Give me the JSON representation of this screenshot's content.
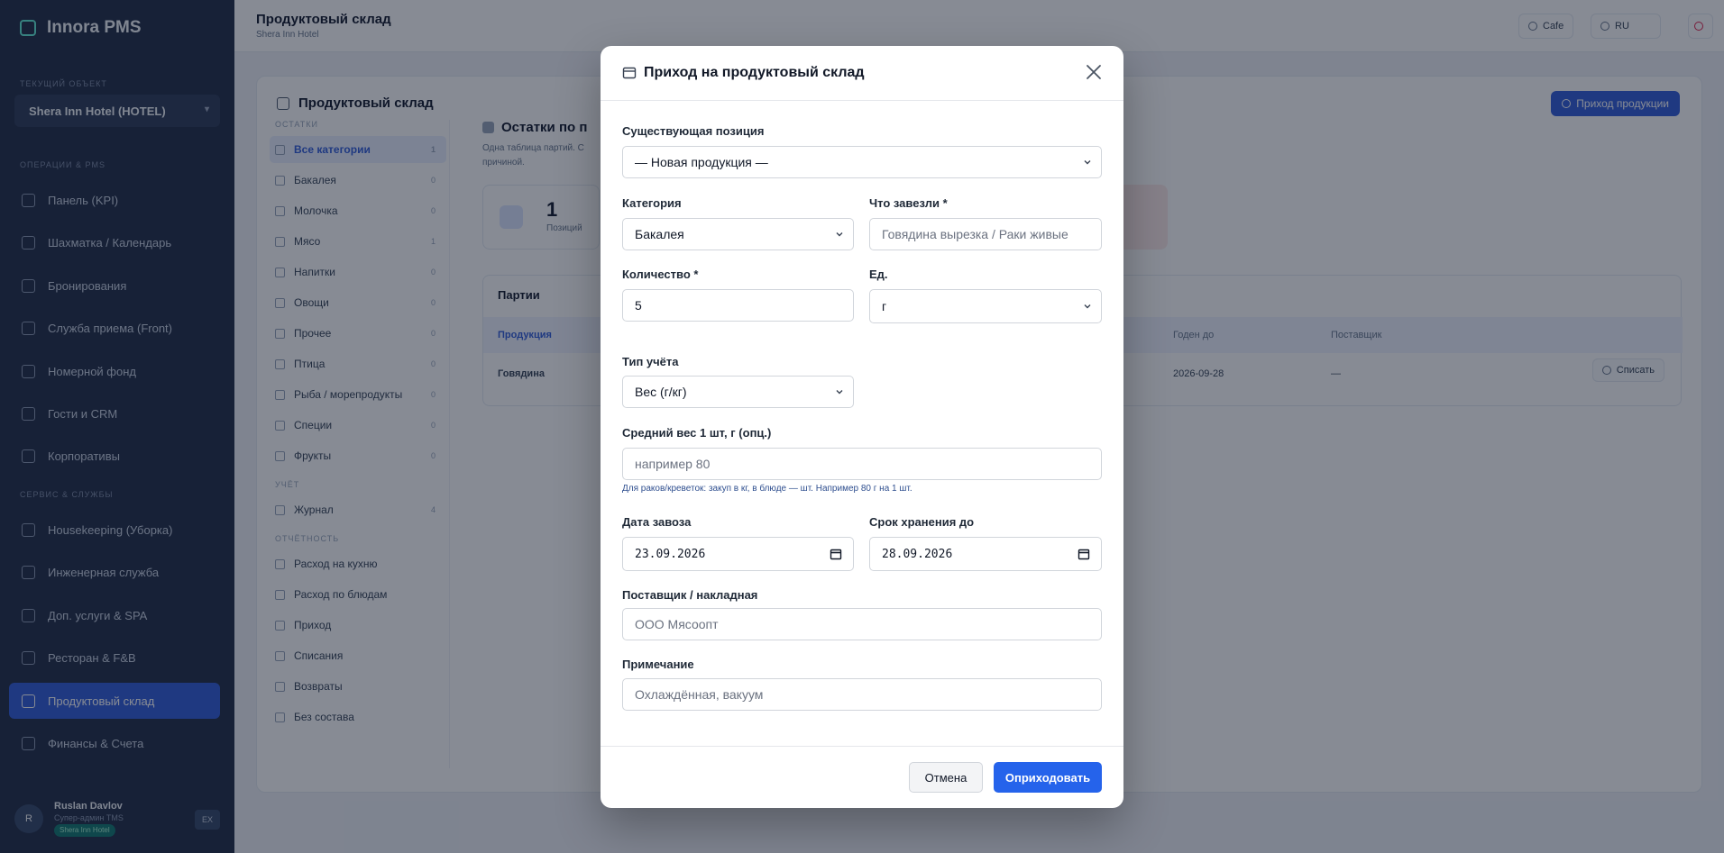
{
  "sidebar": {
    "brand": "Innora PMS",
    "hotel_section": "Текущий объект",
    "hotel": "Shera Inn Hotel (HOTEL)",
    "section_ops": "Операции & PMS",
    "section_services": "Сервис & службы",
    "ops_items": [
      "Панель (KPI)",
      "Шахматка / Календарь",
      "Бронирования",
      "Служба приема (Front)",
      "Номерной фонд",
      "Гости и CRM",
      "Корпоративы"
    ],
    "service_items": [
      "Housekeeping (Уборка)",
      "Инженерная служба",
      "Доп. услуги & SPA",
      "Ресторан & F&B",
      "Продуктовый склад",
      "Финансы & Счета"
    ],
    "user": {
      "initials": "R",
      "name": "Ruslan Davlov",
      "role": "Супер-админ TMS",
      "badge": "Shera Inn Hotel",
      "logout": "EX"
    }
  },
  "header": {
    "title": "Продуктовый склад",
    "subtitle": "Shera Inn Hotel",
    "btn_cafe": "Cafe",
    "btn_lang": "RU"
  },
  "card": {
    "title": "Продуктовый склад",
    "primary_btn": "Приход продукции",
    "subnav": {
      "sec_stock": "Остатки",
      "items": [
        {
          "label": "Все категории",
          "count": "1"
        },
        {
          "label": "Бакалея",
          "count": "0"
        },
        {
          "label": "Молочка",
          "count": "0"
        },
        {
          "label": "Мясо",
          "count": "1"
        },
        {
          "label": "Напитки",
          "count": "0"
        },
        {
          "label": "Овощи",
          "count": "0"
        },
        {
          "label": "Прочее",
          "count": "0"
        },
        {
          "label": "Птица",
          "count": "0"
        },
        {
          "label": "Рыба / морепродукты",
          "count": "0"
        },
        {
          "label": "Специи",
          "count": "0"
        },
        {
          "label": "Фрукты",
          "count": "0"
        }
      ],
      "sec_log": "Учёт",
      "log_items": [
        {
          "label": "Журнал",
          "count": "4"
        }
      ],
      "sec_reports": "Отчётность",
      "report_items": [
        "Расход на кухню",
        "Расход по блюдам",
        "Приход",
        "Списания",
        "Возвраты",
        "Без состава"
      ]
    },
    "content": {
      "title": "Остатки по п",
      "desc": "Одна таблица партий. С причиной.",
      "stat_value": "1",
      "stat_label": "Позиций",
      "table_title": "Партии",
      "th_product": "Продукция",
      "th_until": "Годен до",
      "th_supplier": "Поставщик",
      "row": {
        "product": "Говядина",
        "until": "2026-09-28",
        "supplier": "—"
      },
      "write_off": "Списать"
    }
  },
  "modal": {
    "title": "Приход на продуктовый склад",
    "existing_label": "Существующая позиция",
    "existing_value": "— Новая продукция —",
    "category_label": "Категория",
    "category_value": "Бакалея",
    "what_label": "Что завезли *",
    "what_placeholder": "Говядина вырезка / Раки живые",
    "qty_label": "Количество *",
    "qty_value": "5",
    "unit_label": "Ед.",
    "unit_value": "г",
    "type_label": "Тип учёта",
    "type_value": "Вес (г/кг)",
    "avg_label": "Средний вес 1 шт, г (опц.)",
    "avg_placeholder": "например 80",
    "avg_hint": "Для раков/креветок: закуп в кг, в блюде — шт. Например 80 г на 1 шт.",
    "date_label": "Дата завоза",
    "date_value": "23.09.2026",
    "expiry_label": "Срок хранения до",
    "expiry_value": "28.09.2026",
    "supplier_label": "Поставщик / накладная",
    "supplier_placeholder": "ООО Мясоопт",
    "note_label": "Примечание",
    "note_placeholder": "Охлаждённая, вакуум",
    "cancel": "Отмена",
    "submit": "Оприходовать"
  }
}
